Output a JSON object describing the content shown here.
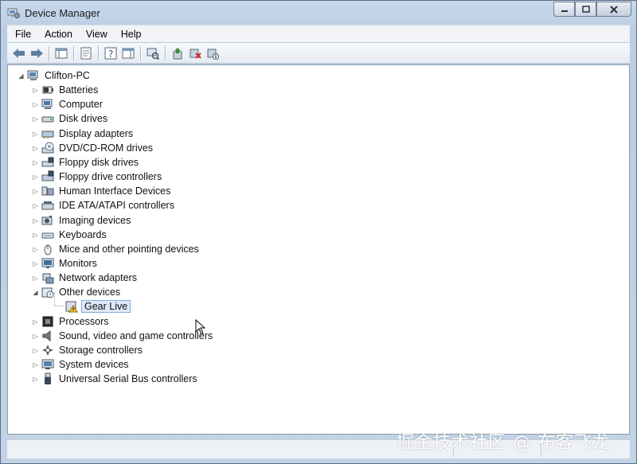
{
  "window": {
    "title": "Device Manager",
    "controls": [
      "minimize",
      "maximize",
      "close"
    ]
  },
  "menu": [
    "File",
    "Action",
    "View",
    "Help"
  ],
  "toolbar": {
    "icons": [
      "back-icon",
      "forward-icon",
      "show-hide-console-tree-icon",
      "properties-icon",
      "help-icon",
      "show-hide-action-pane-icon",
      "scan-hardware-icon",
      "update-driver-icon",
      "uninstall-icon",
      "disable-icon"
    ]
  },
  "tree": {
    "root": "Clifton-PC",
    "categories": [
      {
        "label": "Batteries",
        "icon": "battery-icon",
        "expanded": false
      },
      {
        "label": "Computer",
        "icon": "computer-icon",
        "expanded": false
      },
      {
        "label": "Disk drives",
        "icon": "disk-drive-icon",
        "expanded": false
      },
      {
        "label": "Display adapters",
        "icon": "display-adapter-icon",
        "expanded": false
      },
      {
        "label": "DVD/CD-ROM drives",
        "icon": "dvd-drive-icon",
        "expanded": false
      },
      {
        "label": "Floppy disk drives",
        "icon": "floppy-drive-icon",
        "expanded": false
      },
      {
        "label": "Floppy drive controllers",
        "icon": "floppy-controller-icon",
        "expanded": false
      },
      {
        "label": "Human Interface Devices",
        "icon": "hid-icon",
        "expanded": false
      },
      {
        "label": "IDE ATA/ATAPI controllers",
        "icon": "ide-controller-icon",
        "expanded": false
      },
      {
        "label": "Imaging devices",
        "icon": "imaging-device-icon",
        "expanded": false
      },
      {
        "label": "Keyboards",
        "icon": "keyboard-icon",
        "expanded": false
      },
      {
        "label": "Mice and other pointing devices",
        "icon": "mouse-icon",
        "expanded": false
      },
      {
        "label": "Monitors",
        "icon": "monitor-icon",
        "expanded": false
      },
      {
        "label": "Network adapters",
        "icon": "network-adapter-icon",
        "expanded": false
      },
      {
        "label": "Other devices",
        "icon": "unknown-device-icon",
        "expanded": true,
        "children": [
          {
            "label": "Gear Live",
            "icon": "warning-device-icon",
            "selected": true
          }
        ]
      },
      {
        "label": "Processors",
        "icon": "processor-icon",
        "expanded": false
      },
      {
        "label": "Sound, video and game controllers",
        "icon": "speaker-icon",
        "expanded": false
      },
      {
        "label": "Storage controllers",
        "icon": "storage-controller-icon",
        "expanded": false
      },
      {
        "label": "System devices",
        "icon": "system-device-icon",
        "expanded": false
      },
      {
        "label": "Universal Serial Bus controllers",
        "icon": "usb-icon",
        "expanded": false
      }
    ]
  },
  "watermark": "掘金技术社区 @ 布客飞龙"
}
